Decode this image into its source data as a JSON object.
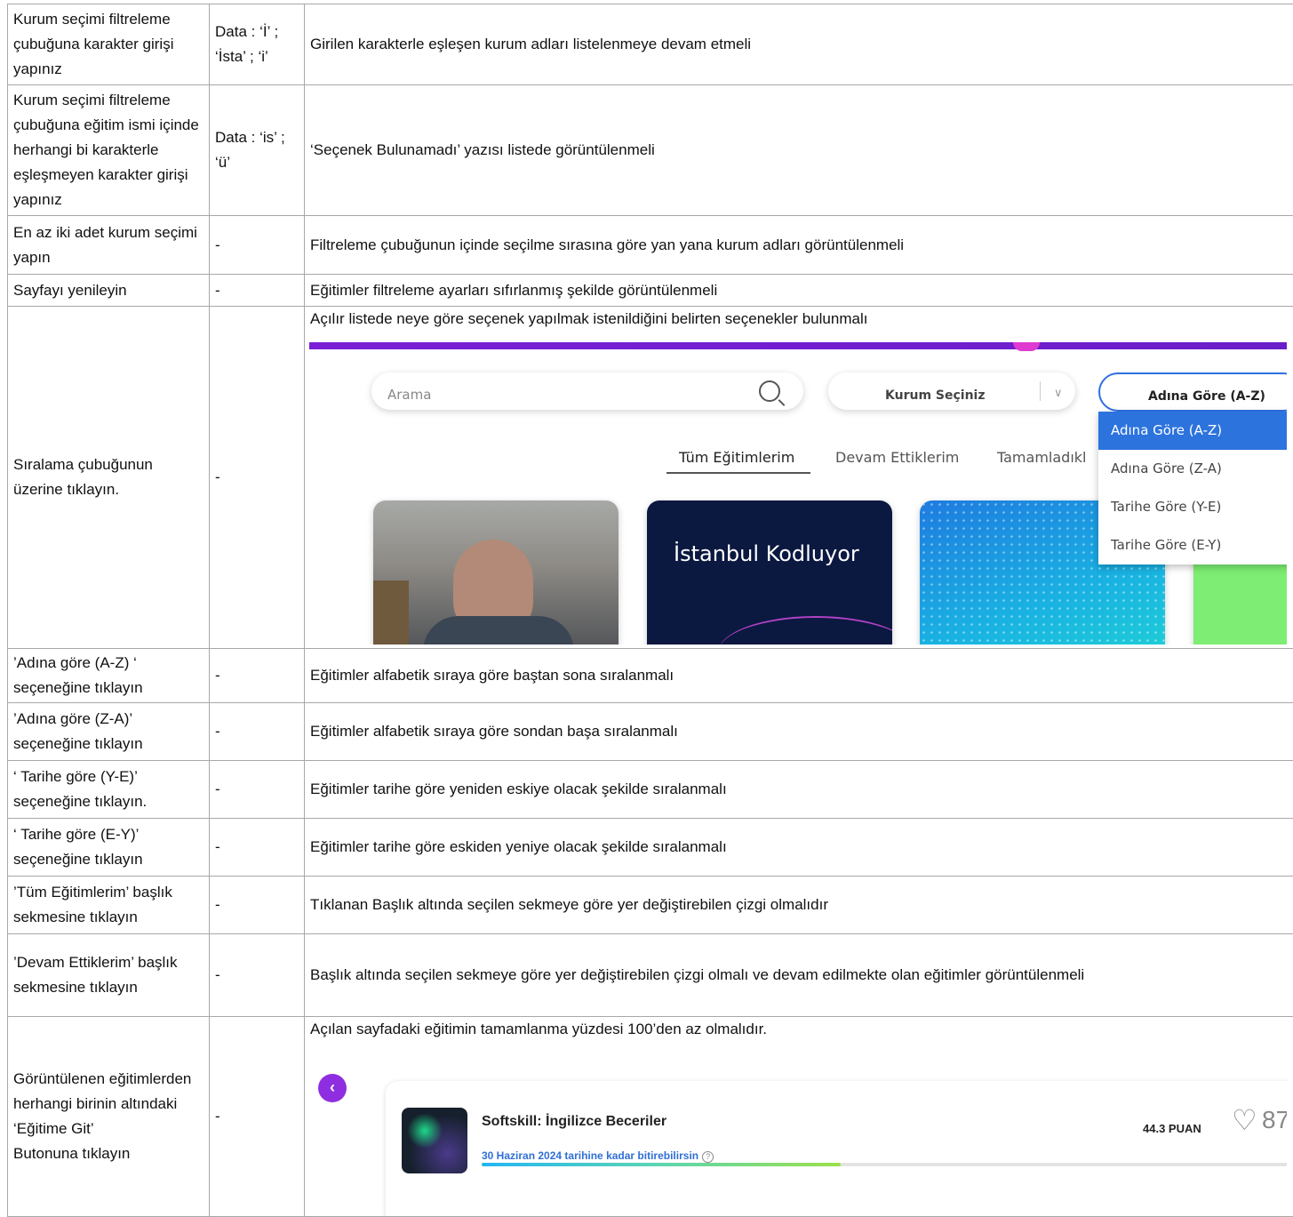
{
  "rows": [
    {
      "step": "Kurum seçimi filtreleme çubuğuna karakter girişi yapınız",
      "data": "Data : ‘İ’ ; ‘İsta’ ; ‘i’",
      "expected": "Girilen karakterle eşleşen kurum adları listelenmeye devam etmeli"
    },
    {
      "step": "Kurum seçimi filtreleme çubuğuna eğitim ismi içinde herhangi bi karakterle eşleşmeyen karakter girişi yapınız",
      "data": "Data : ‘is’ ; ‘ü’",
      "expected": "‘Seçenek Bulunamadı’ yazısı listede görüntülenmeli"
    },
    {
      "step": "En az iki adet kurum seçimi yapın",
      "data": "-",
      "expected": "Filtreleme çubuğunun içinde seçilme sırasına göre yan yana kurum adları görüntülenmeli"
    },
    {
      "step": "Sayfayı yenileyin",
      "data": "-",
      "expected": "Eğitimler filtreleme ayarları sıfırlanmış şekilde görüntülenmeli"
    },
    {
      "step": "Sıralama çubuğunun üzerine tıklayın.",
      "data": "-",
      "expected": "Açılır listede neye göre seçenek yapılmak istenildiğini belirten seçenekler bulunmalı"
    },
    {
      "step": "’Adına göre (A-Z) ‘ seçeneğine tıklayın",
      "data": "-",
      "expected": "Eğitimler alfabetik sıraya göre baştan sona sıralanmalı"
    },
    {
      "step": "’Adına göre (Z-A)’ seçeneğine tıklayın",
      "data": "-",
      "expected": "Eğitimler alfabetik sıraya göre sondan başa sıralanmalı"
    },
    {
      "step": "‘ Tarihe göre (Y-E)’ seçeneğine tıklayın.",
      "data": "-",
      "expected": "Eğitimler tarihe göre yeniden eskiye olacak şekilde sıralanmalı"
    },
    {
      "step": "‘ Tarihe göre (E-Y)’ seçeneğine tıklayın",
      "data": "-",
      "expected": "Eğitimler tarihe göre eskiden yeniye olacak şekilde sıralanmalı"
    },
    {
      "step": "’Tüm Eğitimlerim’ başlık sekmesine tıklayın",
      "data": "-",
      "expected": "Tıklanan Başlık altında seçilen sekmeye göre yer değiştirebilen çizgi olmalıdır"
    },
    {
      "step": "’Devam Ettiklerim’ başlık sekmesine tıklayın",
      "data": "-",
      "expected": "Başlık altında seçilen sekmeye göre yer değiştirebilen çizgi olmalı ve devam edilmekte olan eğitimler görüntülenmeli"
    },
    {
      "step": "Görüntülenen eğitimlerden herhangi birinin altındaki ‘Eğitime Git’\nButonuna tıklayın",
      "data": "-",
      "expected": "Açılan sayfadaki eğitimin tamamlanma yüzdesi 100’den az olmalıdır."
    }
  ],
  "shot1": {
    "search_placeholder": "Arama",
    "kurum_label": "Kurum Seçiniz",
    "sort_label": "Adına Göre (A-Z)",
    "tabs": [
      "Tüm Eğitimlerim",
      "Devam Ettiklerim",
      "Tamamladıkl"
    ],
    "dropdown": [
      "Adına Göre (A-Z)",
      "Adına Göre (Z-A)",
      "Tarihe Göre (Y-E)",
      "Tarihe Göre (E-Y)"
    ],
    "card_title": "İstanbul Kodluyor",
    "accent": "#2c73de"
  },
  "shot2": {
    "course_title": "Softskill: İngilizce Beceriler",
    "deadline": "30 Haziran 2024 tarihine kadar bitirebilirsin",
    "points": "44.3 PUAN",
    "likes": "87",
    "progress": 0.43,
    "back_icon": "chevron-left-icon"
  }
}
